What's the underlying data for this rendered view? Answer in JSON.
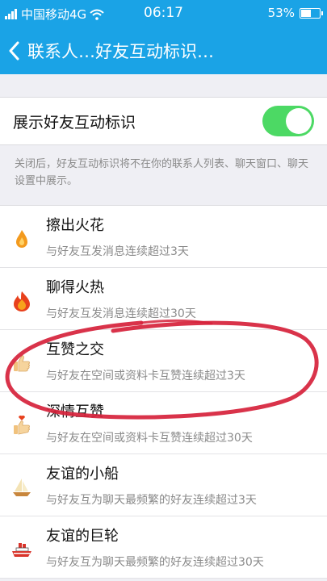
{
  "status_bar": {
    "carrier": "中国移动4G",
    "time": "06:17",
    "battery": "53%",
    "battery_level": 0.53
  },
  "header": {
    "title": "联系人…好友互动标识…"
  },
  "settings": {
    "toggle_label": "展示好友互动标识",
    "toggle_on": true,
    "toggle_color": "#4cd964",
    "note": "关闭后，好友互动标识将不在你的联系人列表、聊天窗口、聊天设置中展示。"
  },
  "items": [
    {
      "name": "擦出火花",
      "desc": "与好友互发消息连续超过3天",
      "icon": "small-flame-icon"
    },
    {
      "name": "聊得火热",
      "desc": "与好友互发消息连续超过30天",
      "icon": "big-flame-icon"
    },
    {
      "name": "互赞之交",
      "desc": "与好友在空间或资料卡互赞连续超过3天",
      "icon": "thumbs-up-icon"
    },
    {
      "name": "深情互赞",
      "desc": "与好友在空间或资料卡互赞连续超过30天",
      "icon": "heart-thumb-icon"
    },
    {
      "name": "友谊的小船",
      "desc": "与好友互为聊天最频繁的好友连续超过3天",
      "icon": "sailboat-icon"
    },
    {
      "name": "友谊的巨轮",
      "desc": "与好友互为聊天最频繁的好友连续超过30天",
      "icon": "ship-icon"
    }
  ],
  "colors": {
    "header_blue": "#1aa3e6",
    "annotation_red": "#d6223b"
  }
}
